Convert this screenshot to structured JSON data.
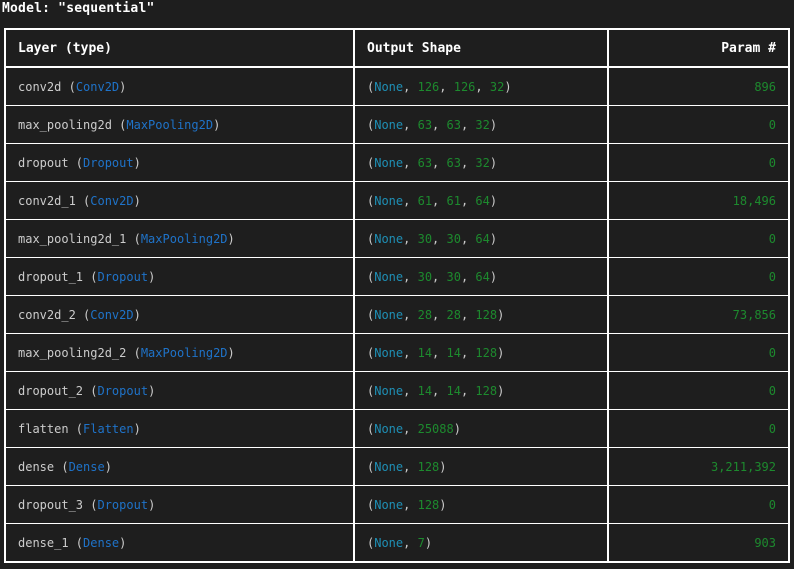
{
  "model_title": "Model: \"sequential\"",
  "headers": {
    "layer": "Layer (type)",
    "shape": "Output Shape",
    "param": "Param #"
  },
  "rows": [
    {
      "name": "conv2d",
      "type": "Conv2D",
      "shape": [
        "126",
        "126",
        "32"
      ],
      "param": "896"
    },
    {
      "name": "max_pooling2d",
      "type": "MaxPooling2D",
      "shape": [
        "63",
        "63",
        "32"
      ],
      "param": "0"
    },
    {
      "name": "dropout",
      "type": "Dropout",
      "shape": [
        "63",
        "63",
        "32"
      ],
      "param": "0"
    },
    {
      "name": "conv2d_1",
      "type": "Conv2D",
      "shape": [
        "61",
        "61",
        "64"
      ],
      "param": "18,496"
    },
    {
      "name": "max_pooling2d_1",
      "type": "MaxPooling2D",
      "shape": [
        "30",
        "30",
        "64"
      ],
      "param": "0"
    },
    {
      "name": "dropout_1",
      "type": "Dropout",
      "shape": [
        "30",
        "30",
        "64"
      ],
      "param": "0"
    },
    {
      "name": "conv2d_2",
      "type": "Conv2D",
      "shape": [
        "28",
        "28",
        "128"
      ],
      "param": "73,856"
    },
    {
      "name": "max_pooling2d_2",
      "type": "MaxPooling2D",
      "shape": [
        "14",
        "14",
        "128"
      ],
      "param": "0"
    },
    {
      "name": "dropout_2",
      "type": "Dropout",
      "shape": [
        "14",
        "14",
        "128"
      ],
      "param": "0"
    },
    {
      "name": "flatten",
      "type": "Flatten",
      "shape": [
        "25088"
      ],
      "param": "0"
    },
    {
      "name": "dense",
      "type": "Dense",
      "shape": [
        "128"
      ],
      "param": "3,211,392"
    },
    {
      "name": "dropout_3",
      "type": "Dropout",
      "shape": [
        "128"
      ],
      "param": "0"
    },
    {
      "name": "dense_1",
      "type": "Dense",
      "shape": [
        "7"
      ],
      "param": "903"
    }
  ],
  "shape_none_label": "None",
  "colors": {
    "background": "#1e1e1e",
    "layer_type": "#1f73c9",
    "number": "#1d8a2e",
    "none_keyword": "#1f8fb5",
    "border": "#ffffff"
  }
}
